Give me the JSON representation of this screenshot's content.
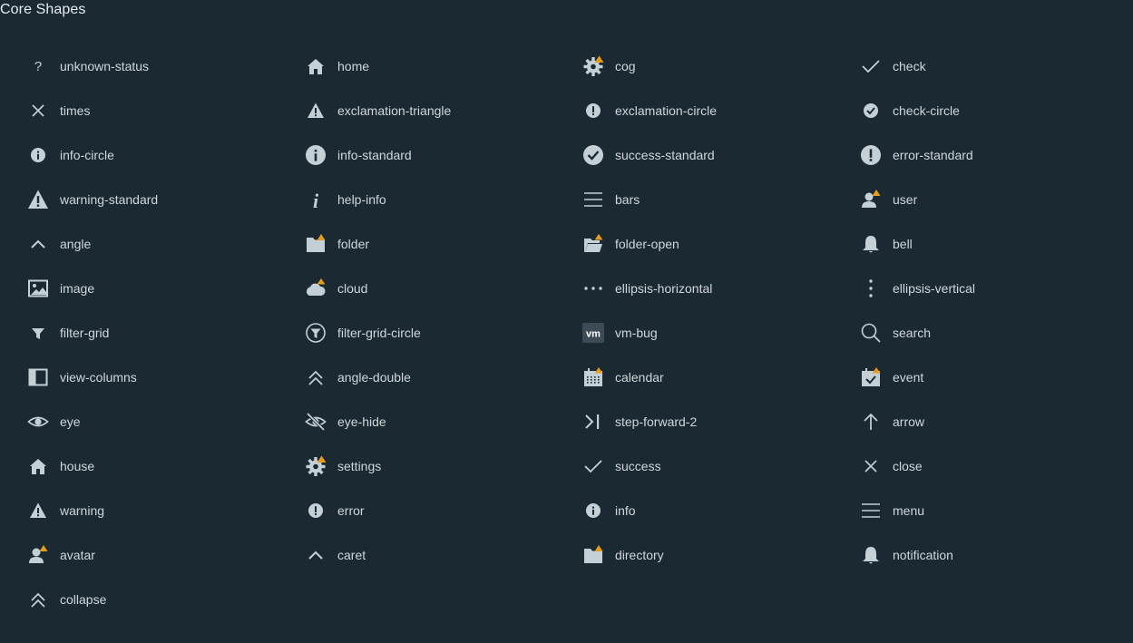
{
  "title": "Core Shapes",
  "colors": {
    "background": "#1b2a32",
    "icon": "#c5d0d6",
    "badge": "#e69c1d",
    "text": "#cfd6db"
  },
  "shapes": [
    {
      "label": "unknown-status",
      "icon": "question-mark-icon"
    },
    {
      "label": "home",
      "icon": "home-icon"
    },
    {
      "label": "cog",
      "icon": "cog-icon"
    },
    {
      "label": "check",
      "icon": "check-icon"
    },
    {
      "label": "times",
      "icon": "times-icon"
    },
    {
      "label": "exclamation-triangle",
      "icon": "exclamation-triangle-icon"
    },
    {
      "label": "exclamation-circle",
      "icon": "exclamation-circle-icon"
    },
    {
      "label": "check-circle",
      "icon": "check-circle-icon"
    },
    {
      "label": "info-circle",
      "icon": "info-circle-icon"
    },
    {
      "label": "info-standard",
      "icon": "info-standard-icon"
    },
    {
      "label": "success-standard",
      "icon": "success-standard-icon"
    },
    {
      "label": "error-standard",
      "icon": "error-standard-icon"
    },
    {
      "label": "warning-standard",
      "icon": "warning-standard-icon"
    },
    {
      "label": "help-info",
      "icon": "help-info-icon"
    },
    {
      "label": "bars",
      "icon": "bars-icon"
    },
    {
      "label": "user",
      "icon": "user-icon"
    },
    {
      "label": "angle",
      "icon": "angle-icon"
    },
    {
      "label": "folder",
      "icon": "folder-icon"
    },
    {
      "label": "folder-open",
      "icon": "folder-open-icon"
    },
    {
      "label": "bell",
      "icon": "bell-icon"
    },
    {
      "label": "image",
      "icon": "image-icon"
    },
    {
      "label": "cloud",
      "icon": "cloud-icon"
    },
    {
      "label": "ellipsis-horizontal",
      "icon": "ellipsis-horizontal-icon"
    },
    {
      "label": "ellipsis-vertical",
      "icon": "ellipsis-vertical-icon"
    },
    {
      "label": "filter-grid",
      "icon": "filter-grid-icon"
    },
    {
      "label": "filter-grid-circle",
      "icon": "filter-grid-circle-icon"
    },
    {
      "label": "vm-bug",
      "icon": "vm-bug-icon",
      "icon_text": "vm"
    },
    {
      "label": "search",
      "icon": "search-icon"
    },
    {
      "label": "view-columns",
      "icon": "view-columns-icon"
    },
    {
      "label": "angle-double",
      "icon": "angle-double-icon"
    },
    {
      "label": "calendar",
      "icon": "calendar-icon"
    },
    {
      "label": "event",
      "icon": "event-icon"
    },
    {
      "label": "eye",
      "icon": "eye-icon"
    },
    {
      "label": "eye-hide",
      "icon": "eye-hide-icon"
    },
    {
      "label": "step-forward-2",
      "icon": "step-forward-2-icon"
    },
    {
      "label": "arrow",
      "icon": "arrow-icon"
    },
    {
      "label": "house",
      "icon": "house-icon"
    },
    {
      "label": "settings",
      "icon": "settings-icon"
    },
    {
      "label": "success",
      "icon": "success-icon"
    },
    {
      "label": "close",
      "icon": "close-icon"
    },
    {
      "label": "warning",
      "icon": "warning-icon"
    },
    {
      "label": "error",
      "icon": "error-icon"
    },
    {
      "label": "info",
      "icon": "info-icon"
    },
    {
      "label": "menu",
      "icon": "menu-icon"
    },
    {
      "label": "avatar",
      "icon": "avatar-icon"
    },
    {
      "label": "caret",
      "icon": "caret-icon"
    },
    {
      "label": "directory",
      "icon": "directory-icon"
    },
    {
      "label": "notification",
      "icon": "notification-icon"
    },
    {
      "label": "collapse",
      "icon": "collapse-icon"
    }
  ]
}
